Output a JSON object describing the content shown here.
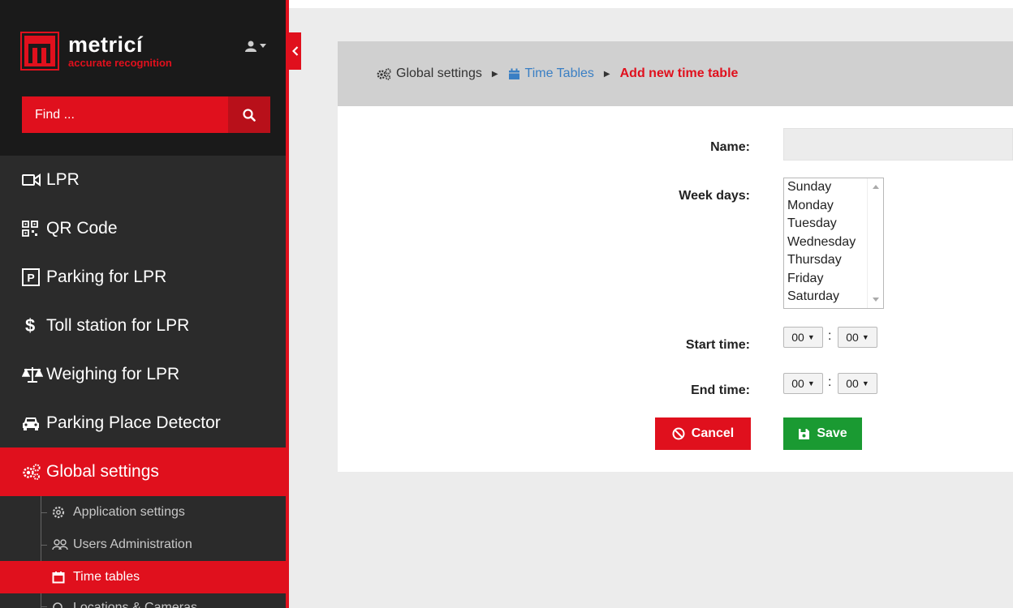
{
  "brand": {
    "name": "metricí",
    "tagline": "accurate recognition",
    "accent": "#e0101d"
  },
  "sidebar": {
    "search_placeholder": "Find ...",
    "menu": [
      {
        "label": "LPR",
        "icon": "video-camera-icon"
      },
      {
        "label": "QR Code",
        "icon": "qr-code-icon"
      },
      {
        "label": "Parking for LPR",
        "icon": "parking-icon"
      },
      {
        "label": "Toll station for LPR",
        "icon": "dollar-icon"
      },
      {
        "label": "Weighing for LPR",
        "icon": "balance-scale-icon"
      },
      {
        "label": "Parking Place Detector",
        "icon": "car-icon"
      },
      {
        "label": "Global settings",
        "icon": "cogs-icon",
        "active": true
      }
    ],
    "submenu": [
      {
        "label": "Application settings",
        "icon": "gear-icon"
      },
      {
        "label": "Users Administration",
        "icon": "users-icon"
      },
      {
        "label": "Time tables",
        "icon": "calendar-icon",
        "active": true
      },
      {
        "label": "Locations & Cameras",
        "icon": "search-icon"
      }
    ]
  },
  "breadcrumb": {
    "root": "Global settings",
    "parent": "Time Tables",
    "current": "Add new time table"
  },
  "form": {
    "name_label": "Name:",
    "name_value": "",
    "weekdays_label": "Week days:",
    "weekdays": [
      "Sunday",
      "Monday",
      "Tuesday",
      "Wednesday",
      "Thursday",
      "Friday",
      "Saturday"
    ],
    "start_label": "Start time:",
    "end_label": "End time:",
    "start_hour": "00",
    "start_minute": "00",
    "end_hour": "00",
    "end_minute": "00",
    "colon": ":",
    "cancel_label": "Cancel",
    "save_label": "Save"
  }
}
